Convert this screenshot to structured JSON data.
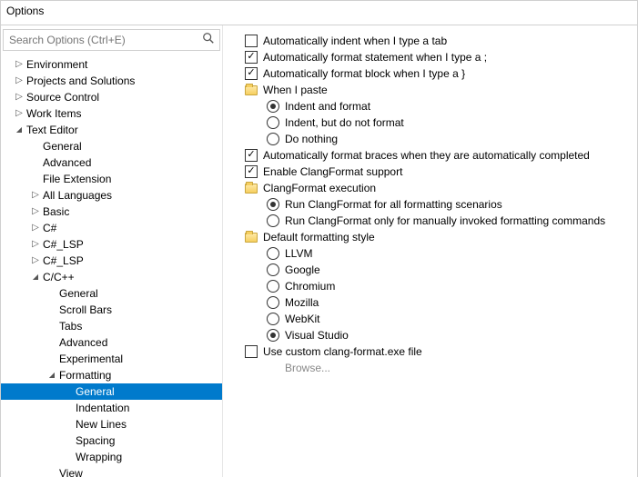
{
  "window": {
    "title": "Options"
  },
  "search": {
    "placeholder": "Search Options (Ctrl+E)"
  },
  "tree": [
    {
      "label": "Environment",
      "depth": 0,
      "arrow": "right"
    },
    {
      "label": "Projects and Solutions",
      "depth": 0,
      "arrow": "right"
    },
    {
      "label": "Source Control",
      "depth": 0,
      "arrow": "right"
    },
    {
      "label": "Work Items",
      "depth": 0,
      "arrow": "right"
    },
    {
      "label": "Text Editor",
      "depth": 0,
      "arrow": "down"
    },
    {
      "label": "General",
      "depth": 1,
      "arrow": "none"
    },
    {
      "label": "Advanced",
      "depth": 1,
      "arrow": "none"
    },
    {
      "label": "File Extension",
      "depth": 1,
      "arrow": "none"
    },
    {
      "label": "All Languages",
      "depth": 1,
      "arrow": "right"
    },
    {
      "label": "Basic",
      "depth": 1,
      "arrow": "right"
    },
    {
      "label": "C#",
      "depth": 1,
      "arrow": "right"
    },
    {
      "label": "C#_LSP",
      "depth": 1,
      "arrow": "right"
    },
    {
      "label": "C#_LSP",
      "depth": 1,
      "arrow": "right"
    },
    {
      "label": "C/C++",
      "depth": 1,
      "arrow": "down"
    },
    {
      "label": "General",
      "depth": 2,
      "arrow": "none"
    },
    {
      "label": "Scroll Bars",
      "depth": 2,
      "arrow": "none"
    },
    {
      "label": "Tabs",
      "depth": 2,
      "arrow": "none"
    },
    {
      "label": "Advanced",
      "depth": 2,
      "arrow": "none"
    },
    {
      "label": "Experimental",
      "depth": 2,
      "arrow": "none"
    },
    {
      "label": "Formatting",
      "depth": 2,
      "arrow": "down"
    },
    {
      "label": "General",
      "depth": 3,
      "arrow": "none",
      "selected": true
    },
    {
      "label": "Indentation",
      "depth": 3,
      "arrow": "none"
    },
    {
      "label": "New Lines",
      "depth": 3,
      "arrow": "none"
    },
    {
      "label": "Spacing",
      "depth": 3,
      "arrow": "none"
    },
    {
      "label": "Wrapping",
      "depth": 3,
      "arrow": "none"
    },
    {
      "label": "View",
      "depth": 2,
      "arrow": "none"
    }
  ],
  "settings": [
    {
      "type": "checkbox",
      "checked": false,
      "indent": 1,
      "label": "Automatically indent when I type a tab"
    },
    {
      "type": "checkbox",
      "checked": true,
      "indent": 1,
      "label": "Automatically format statement when I type a ;"
    },
    {
      "type": "checkbox",
      "checked": true,
      "indent": 1,
      "label": "Automatically format block when I type a }"
    },
    {
      "type": "group",
      "indent": 1,
      "label": "When I paste"
    },
    {
      "type": "radio",
      "checked": true,
      "indent": 2,
      "label": "Indent and format"
    },
    {
      "type": "radio",
      "checked": false,
      "indent": 2,
      "label": "Indent, but do not format"
    },
    {
      "type": "radio",
      "checked": false,
      "indent": 2,
      "label": "Do nothing"
    },
    {
      "type": "checkbox",
      "checked": true,
      "indent": 1,
      "label": "Automatically format braces when they are automatically completed"
    },
    {
      "type": "checkbox",
      "checked": true,
      "indent": 1,
      "label": "Enable ClangFormat support"
    },
    {
      "type": "group",
      "indent": 1,
      "label": "ClangFormat execution"
    },
    {
      "type": "radio",
      "checked": true,
      "indent": 2,
      "label": "Run ClangFormat for all formatting scenarios"
    },
    {
      "type": "radio",
      "checked": false,
      "indent": 2,
      "label": "Run ClangFormat only for manually invoked formatting commands"
    },
    {
      "type": "group",
      "indent": 1,
      "label": "Default formatting style"
    },
    {
      "type": "radio",
      "checked": false,
      "indent": 2,
      "label": "LLVM"
    },
    {
      "type": "radio",
      "checked": false,
      "indent": 2,
      "label": "Google"
    },
    {
      "type": "radio",
      "checked": false,
      "indent": 2,
      "label": "Chromium"
    },
    {
      "type": "radio",
      "checked": false,
      "indent": 2,
      "label": "Mozilla"
    },
    {
      "type": "radio",
      "checked": false,
      "indent": 2,
      "label": "WebKit"
    },
    {
      "type": "radio",
      "checked": true,
      "indent": 2,
      "label": "Visual Studio"
    },
    {
      "type": "checkbox",
      "checked": false,
      "indent": 1,
      "label": "Use custom clang-format.exe file"
    },
    {
      "type": "browse",
      "label": "Browse..."
    }
  ]
}
